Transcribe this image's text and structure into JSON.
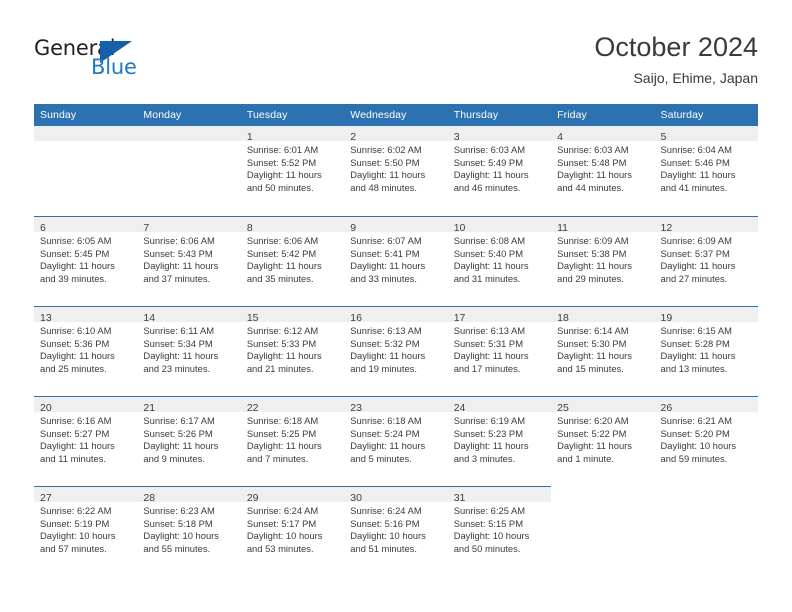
{
  "brand": {
    "name_top": "General",
    "name_bottom": "Blue",
    "triangle_icon": "triangle-icon",
    "accent_color": "#1f7ac4",
    "triangle_color": "#1560a8"
  },
  "header": {
    "title": "October 2024",
    "subtitle": "Saijo, Ehime, Japan",
    "header_bg_color": "#2d72b0",
    "daynum_band_color": "#efefef"
  },
  "weekday_headers": [
    "Sunday",
    "Monday",
    "Tuesday",
    "Wednesday",
    "Thursday",
    "Friday",
    "Saturday"
  ],
  "labels": {
    "sunrise_prefix": "Sunrise:",
    "sunset_prefix": "Sunset:",
    "daylight_prefix": "Daylight:"
  },
  "weeks": [
    [
      {
        "day": "",
        "lines": []
      },
      {
        "day": "",
        "lines": []
      },
      {
        "day": "1",
        "lines": [
          "Sunrise: 6:01 AM",
          "Sunset: 5:52 PM",
          "Daylight: 11 hours",
          "and 50 minutes."
        ]
      },
      {
        "day": "2",
        "lines": [
          "Sunrise: 6:02 AM",
          "Sunset: 5:50 PM",
          "Daylight: 11 hours",
          "and 48 minutes."
        ]
      },
      {
        "day": "3",
        "lines": [
          "Sunrise: 6:03 AM",
          "Sunset: 5:49 PM",
          "Daylight: 11 hours",
          "and 46 minutes."
        ]
      },
      {
        "day": "4",
        "lines": [
          "Sunrise: 6:03 AM",
          "Sunset: 5:48 PM",
          "Daylight: 11 hours",
          "and 44 minutes."
        ]
      },
      {
        "day": "5",
        "lines": [
          "Sunrise: 6:04 AM",
          "Sunset: 5:46 PM",
          "Daylight: 11 hours",
          "and 41 minutes."
        ]
      }
    ],
    [
      {
        "day": "6",
        "lines": [
          "Sunrise: 6:05 AM",
          "Sunset: 5:45 PM",
          "Daylight: 11 hours",
          "and 39 minutes."
        ]
      },
      {
        "day": "7",
        "lines": [
          "Sunrise: 6:06 AM",
          "Sunset: 5:43 PM",
          "Daylight: 11 hours",
          "and 37 minutes."
        ]
      },
      {
        "day": "8",
        "lines": [
          "Sunrise: 6:06 AM",
          "Sunset: 5:42 PM",
          "Daylight: 11 hours",
          "and 35 minutes."
        ]
      },
      {
        "day": "9",
        "lines": [
          "Sunrise: 6:07 AM",
          "Sunset: 5:41 PM",
          "Daylight: 11 hours",
          "and 33 minutes."
        ]
      },
      {
        "day": "10",
        "lines": [
          "Sunrise: 6:08 AM",
          "Sunset: 5:40 PM",
          "Daylight: 11 hours",
          "and 31 minutes."
        ]
      },
      {
        "day": "11",
        "lines": [
          "Sunrise: 6:09 AM",
          "Sunset: 5:38 PM",
          "Daylight: 11 hours",
          "and 29 minutes."
        ]
      },
      {
        "day": "12",
        "lines": [
          "Sunrise: 6:09 AM",
          "Sunset: 5:37 PM",
          "Daylight: 11 hours",
          "and 27 minutes."
        ]
      }
    ],
    [
      {
        "day": "13",
        "lines": [
          "Sunrise: 6:10 AM",
          "Sunset: 5:36 PM",
          "Daylight: 11 hours",
          "and 25 minutes."
        ]
      },
      {
        "day": "14",
        "lines": [
          "Sunrise: 6:11 AM",
          "Sunset: 5:34 PM",
          "Daylight: 11 hours",
          "and 23 minutes."
        ]
      },
      {
        "day": "15",
        "lines": [
          "Sunrise: 6:12 AM",
          "Sunset: 5:33 PM",
          "Daylight: 11 hours",
          "and 21 minutes."
        ]
      },
      {
        "day": "16",
        "lines": [
          "Sunrise: 6:13 AM",
          "Sunset: 5:32 PM",
          "Daylight: 11 hours",
          "and 19 minutes."
        ]
      },
      {
        "day": "17",
        "lines": [
          "Sunrise: 6:13 AM",
          "Sunset: 5:31 PM",
          "Daylight: 11 hours",
          "and 17 minutes."
        ]
      },
      {
        "day": "18",
        "lines": [
          "Sunrise: 6:14 AM",
          "Sunset: 5:30 PM",
          "Daylight: 11 hours",
          "and 15 minutes."
        ]
      },
      {
        "day": "19",
        "lines": [
          "Sunrise: 6:15 AM",
          "Sunset: 5:28 PM",
          "Daylight: 11 hours",
          "and 13 minutes."
        ]
      }
    ],
    [
      {
        "day": "20",
        "lines": [
          "Sunrise: 6:16 AM",
          "Sunset: 5:27 PM",
          "Daylight: 11 hours",
          "and 11 minutes."
        ]
      },
      {
        "day": "21",
        "lines": [
          "Sunrise: 6:17 AM",
          "Sunset: 5:26 PM",
          "Daylight: 11 hours",
          "and 9 minutes."
        ]
      },
      {
        "day": "22",
        "lines": [
          "Sunrise: 6:18 AM",
          "Sunset: 5:25 PM",
          "Daylight: 11 hours",
          "and 7 minutes."
        ]
      },
      {
        "day": "23",
        "lines": [
          "Sunrise: 6:18 AM",
          "Sunset: 5:24 PM",
          "Daylight: 11 hours",
          "and 5 minutes."
        ]
      },
      {
        "day": "24",
        "lines": [
          "Sunrise: 6:19 AM",
          "Sunset: 5:23 PM",
          "Daylight: 11 hours",
          "and 3 minutes."
        ]
      },
      {
        "day": "25",
        "lines": [
          "Sunrise: 6:20 AM",
          "Sunset: 5:22 PM",
          "Daylight: 11 hours",
          "and 1 minute."
        ]
      },
      {
        "day": "26",
        "lines": [
          "Sunrise: 6:21 AM",
          "Sunset: 5:20 PM",
          "Daylight: 10 hours",
          "and 59 minutes."
        ]
      }
    ],
    [
      {
        "day": "27",
        "lines": [
          "Sunrise: 6:22 AM",
          "Sunset: 5:19 PM",
          "Daylight: 10 hours",
          "and 57 minutes."
        ]
      },
      {
        "day": "28",
        "lines": [
          "Sunrise: 6:23 AM",
          "Sunset: 5:18 PM",
          "Daylight: 10 hours",
          "and 55 minutes."
        ]
      },
      {
        "day": "29",
        "lines": [
          "Sunrise: 6:24 AM",
          "Sunset: 5:17 PM",
          "Daylight: 10 hours",
          "and 53 minutes."
        ]
      },
      {
        "day": "30",
        "lines": [
          "Sunrise: 6:24 AM",
          "Sunset: 5:16 PM",
          "Daylight: 10 hours",
          "and 51 minutes."
        ]
      },
      {
        "day": "31",
        "lines": [
          "Sunrise: 6:25 AM",
          "Sunset: 5:15 PM",
          "Daylight: 10 hours",
          "and 50 minutes."
        ]
      },
      {
        "day": "",
        "lines": []
      },
      {
        "day": "",
        "lines": []
      }
    ]
  ]
}
